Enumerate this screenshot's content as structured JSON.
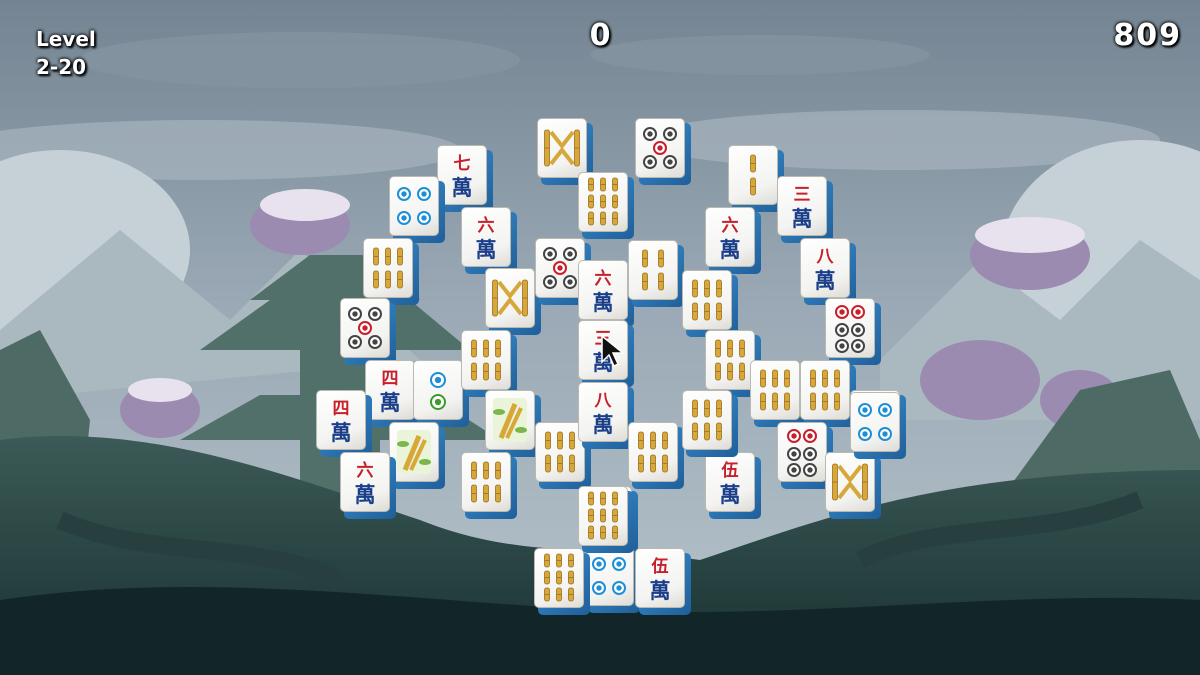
{
  "hud": {
    "level_label": "Level",
    "level_value": "2-20",
    "score": "0",
    "timer": "809"
  },
  "colors": {
    "tile_face": "#f6f6f4",
    "tile_side": "#2e7fc2",
    "character_red": "#c8202a",
    "character_blue": "#1b3f8a",
    "bamboo": "#d7a73a",
    "dot_blue": "#1d8fd6",
    "dot_green": "#3c9a2a"
  },
  "tiles": [
    {
      "name": "tile-character-7",
      "type": "char",
      "num": "七"
    },
    {
      "name": "tile-dots-4-blue",
      "type": "dots4"
    },
    {
      "name": "tile-bamboo-6",
      "type": "bamboo6"
    },
    {
      "name": "tile-dots-4-mixed",
      "type": "dots4m"
    },
    {
      "name": "tile-character-4",
      "type": "char",
      "num": "四"
    },
    {
      "name": "tile-character-4",
      "type": "char",
      "num": "四"
    },
    {
      "name": "tile-character-6",
      "type": "char",
      "num": "六"
    },
    {
      "name": "tile-dots-2",
      "type": "dots2"
    },
    {
      "name": "tile-bamboo-flower",
      "type": "flower"
    },
    {
      "name": "tile-character-6",
      "type": "char",
      "num": "六"
    },
    {
      "name": "tile-bamboo-zigzag",
      "type": "zigzag"
    },
    {
      "name": "tile-bamboo-6",
      "type": "bamboo6"
    },
    {
      "name": "tile-bamboo-flower",
      "type": "flower"
    },
    {
      "name": "tile-bamboo-6",
      "type": "bamboo6"
    },
    {
      "name": "tile-bamboo-zigzag",
      "type": "zigzag"
    },
    {
      "name": "tile-bamboo-6",
      "type": "bamboo6"
    },
    {
      "name": "tile-dots-4-mixed",
      "type": "dots4m"
    },
    {
      "name": "tile-dots-4-mixed",
      "type": "dots4m"
    },
    {
      "name": "tile-bamboo-9",
      "type": "bamboo9"
    },
    {
      "name": "tile-character-6",
      "type": "char",
      "num": "六"
    },
    {
      "name": "tile-character-3",
      "type": "char",
      "num": "三"
    },
    {
      "name": "tile-character-8",
      "type": "char",
      "num": "八"
    },
    {
      "name": "tile-bamboo-4",
      "type": "bamboo4"
    },
    {
      "name": "tile-bamboo-6",
      "type": "bamboo6"
    },
    {
      "name": "tile-dots-2",
      "type": "dots2"
    },
    {
      "name": "tile-dots-4-blue",
      "type": "dots4"
    },
    {
      "name": "tile-bamboo-9",
      "type": "bamboo9"
    },
    {
      "name": "tile-bamboo-2",
      "type": "bamboo2"
    },
    {
      "name": "tile-character-6",
      "type": "char",
      "num": "六"
    },
    {
      "name": "tile-bamboo-6",
      "type": "bamboo6"
    },
    {
      "name": "tile-bamboo-6",
      "type": "bamboo6"
    },
    {
      "name": "tile-character-5",
      "type": "char",
      "num": "伍"
    },
    {
      "name": "tile-character-3",
      "type": "char",
      "num": "三"
    },
    {
      "name": "tile-character-8",
      "type": "char",
      "num": "八"
    },
    {
      "name": "tile-dots-6",
      "type": "dots6"
    },
    {
      "name": "tile-bamboo-6",
      "type": "bamboo6"
    },
    {
      "name": "tile-bamboo-6",
      "type": "bamboo6"
    },
    {
      "name": "tile-dots-3",
      "type": "dots3"
    },
    {
      "name": "tile-dots-6",
      "type": "dots6"
    },
    {
      "name": "tile-bamboo-zigzag",
      "type": "zigzag"
    },
    {
      "name": "tile-bamboo-6",
      "type": "bamboo6"
    },
    {
      "name": "tile-bamboo-9",
      "type": "bamboo9"
    },
    {
      "name": "tile-dots-4-blue",
      "type": "dots4"
    },
    {
      "name": "tile-character-5",
      "type": "char",
      "num": "伍"
    }
  ]
}
